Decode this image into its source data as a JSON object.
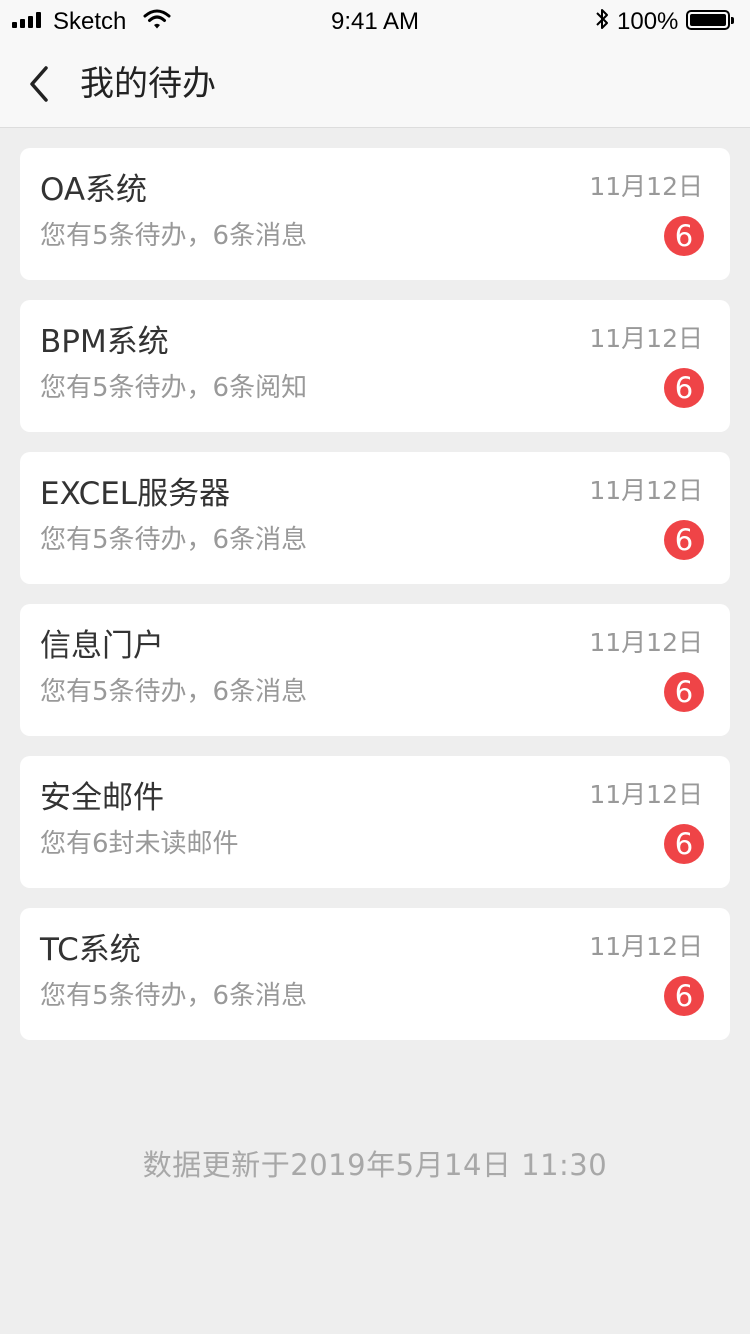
{
  "status_bar": {
    "carrier": "Sketch",
    "time": "9:41 AM",
    "battery": "100%",
    "icons": [
      "signal-icon",
      "wifi-icon",
      "bluetooth-icon",
      "battery-icon"
    ]
  },
  "nav": {
    "title": "我的待办",
    "back_icon": "chevron-left-icon"
  },
  "colors": {
    "badge": "#ef4447",
    "background": "#eeeeee",
    "card": "#ffffff",
    "secondary_text": "#999999"
  },
  "items": [
    {
      "title": "OA系统",
      "subtitle": "您有5条待办，6条消息",
      "date": "11月12日",
      "badge": "6"
    },
    {
      "title": "BPM系统",
      "subtitle": "您有5条待办，6条阅知",
      "date": "11月12日",
      "badge": "6"
    },
    {
      "title": "EXCEL服务器",
      "subtitle": "您有5条待办，6条消息",
      "date": "11月12日",
      "badge": "6"
    },
    {
      "title": "信息门户",
      "subtitle": "您有5条待办，6条消息",
      "date": "11月12日",
      "badge": "6"
    },
    {
      "title": "安全邮件",
      "subtitle": "您有6封未读邮件",
      "date": "11月12日",
      "badge": "6"
    },
    {
      "title": "TC系统",
      "subtitle": "您有5条待办，6条消息",
      "date": "11月12日",
      "badge": "6"
    }
  ],
  "footer": {
    "updated_text": "数据更新于2019年5月14日 11:30"
  }
}
